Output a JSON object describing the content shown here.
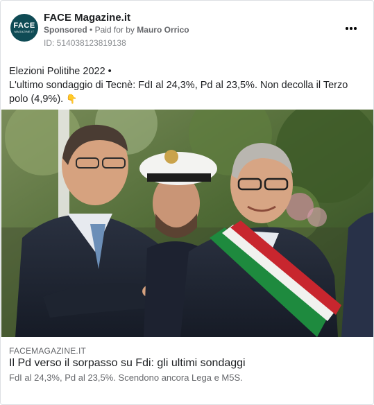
{
  "post": {
    "page_name": "FACE Magazine.it",
    "logo_text": "FACE",
    "logo_subtext": "MAGAZINE.IT",
    "sponsored_label": "Sponsored",
    "separator": "•",
    "paid_for_prefix": "Paid for by",
    "paid_for_name": "Mauro Orrico",
    "ad_id": "ID: 514038123819138",
    "more_icon": "more-horizontal-icon"
  },
  "body": {
    "line1": "Elezioni Politihe 2022 •",
    "line2": "L'ultimo sondaggio di Tecnè: FdI al 24,3%, Pd al 23,5%. Non decolla il Terzo polo (4,9%).",
    "emoji": "👇"
  },
  "link": {
    "domain": "FACEMAGAZINE.IT",
    "headline": "Il Pd verso il sorpasso su Fdi: gli ultimi sondaggi",
    "description": "FdI al 24,3%, Pd al 23,5%. Scendono ancora Lega e M5S."
  },
  "colors": {
    "logo_bg": "#0f4b55",
    "secondary_text": "#65676b"
  }
}
